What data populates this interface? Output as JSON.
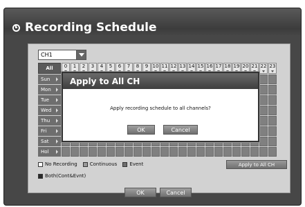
{
  "window": {
    "title": "Recording Schedule"
  },
  "channel_select": {
    "value": "CH1"
  },
  "grid": {
    "all_label": "All",
    "hours": [
      "0",
      "1",
      "2",
      "3",
      "4",
      "5",
      "6",
      "7",
      "8",
      "9",
      "10",
      "11",
      "12",
      "13",
      "14",
      "15",
      "16",
      "17",
      "18",
      "19",
      "20",
      "21",
      "22",
      "23"
    ],
    "days": [
      "Sun",
      "Mon",
      "Tue",
      "Wed",
      "Thu",
      "Fri",
      "Sat",
      "Hol"
    ]
  },
  "legend": {
    "items": [
      {
        "label": "No Recording",
        "color": "#ffffff"
      },
      {
        "label": "Continuous",
        "color": "#9a9a9a"
      },
      {
        "label": "Event",
        "color": "#6e6e6e"
      },
      {
        "label": "Both(Cont&Evnt)",
        "color": "#2a2a2a"
      }
    ]
  },
  "apply_all_button": "Apply to All CH",
  "footer": {
    "ok_label": "OK",
    "cancel_label": "Cancel"
  },
  "dialog": {
    "title": "Apply to All CH",
    "message": "Apply recording schedule to all channels?",
    "ok_label": "OK",
    "cancel_label": "Cancel"
  }
}
